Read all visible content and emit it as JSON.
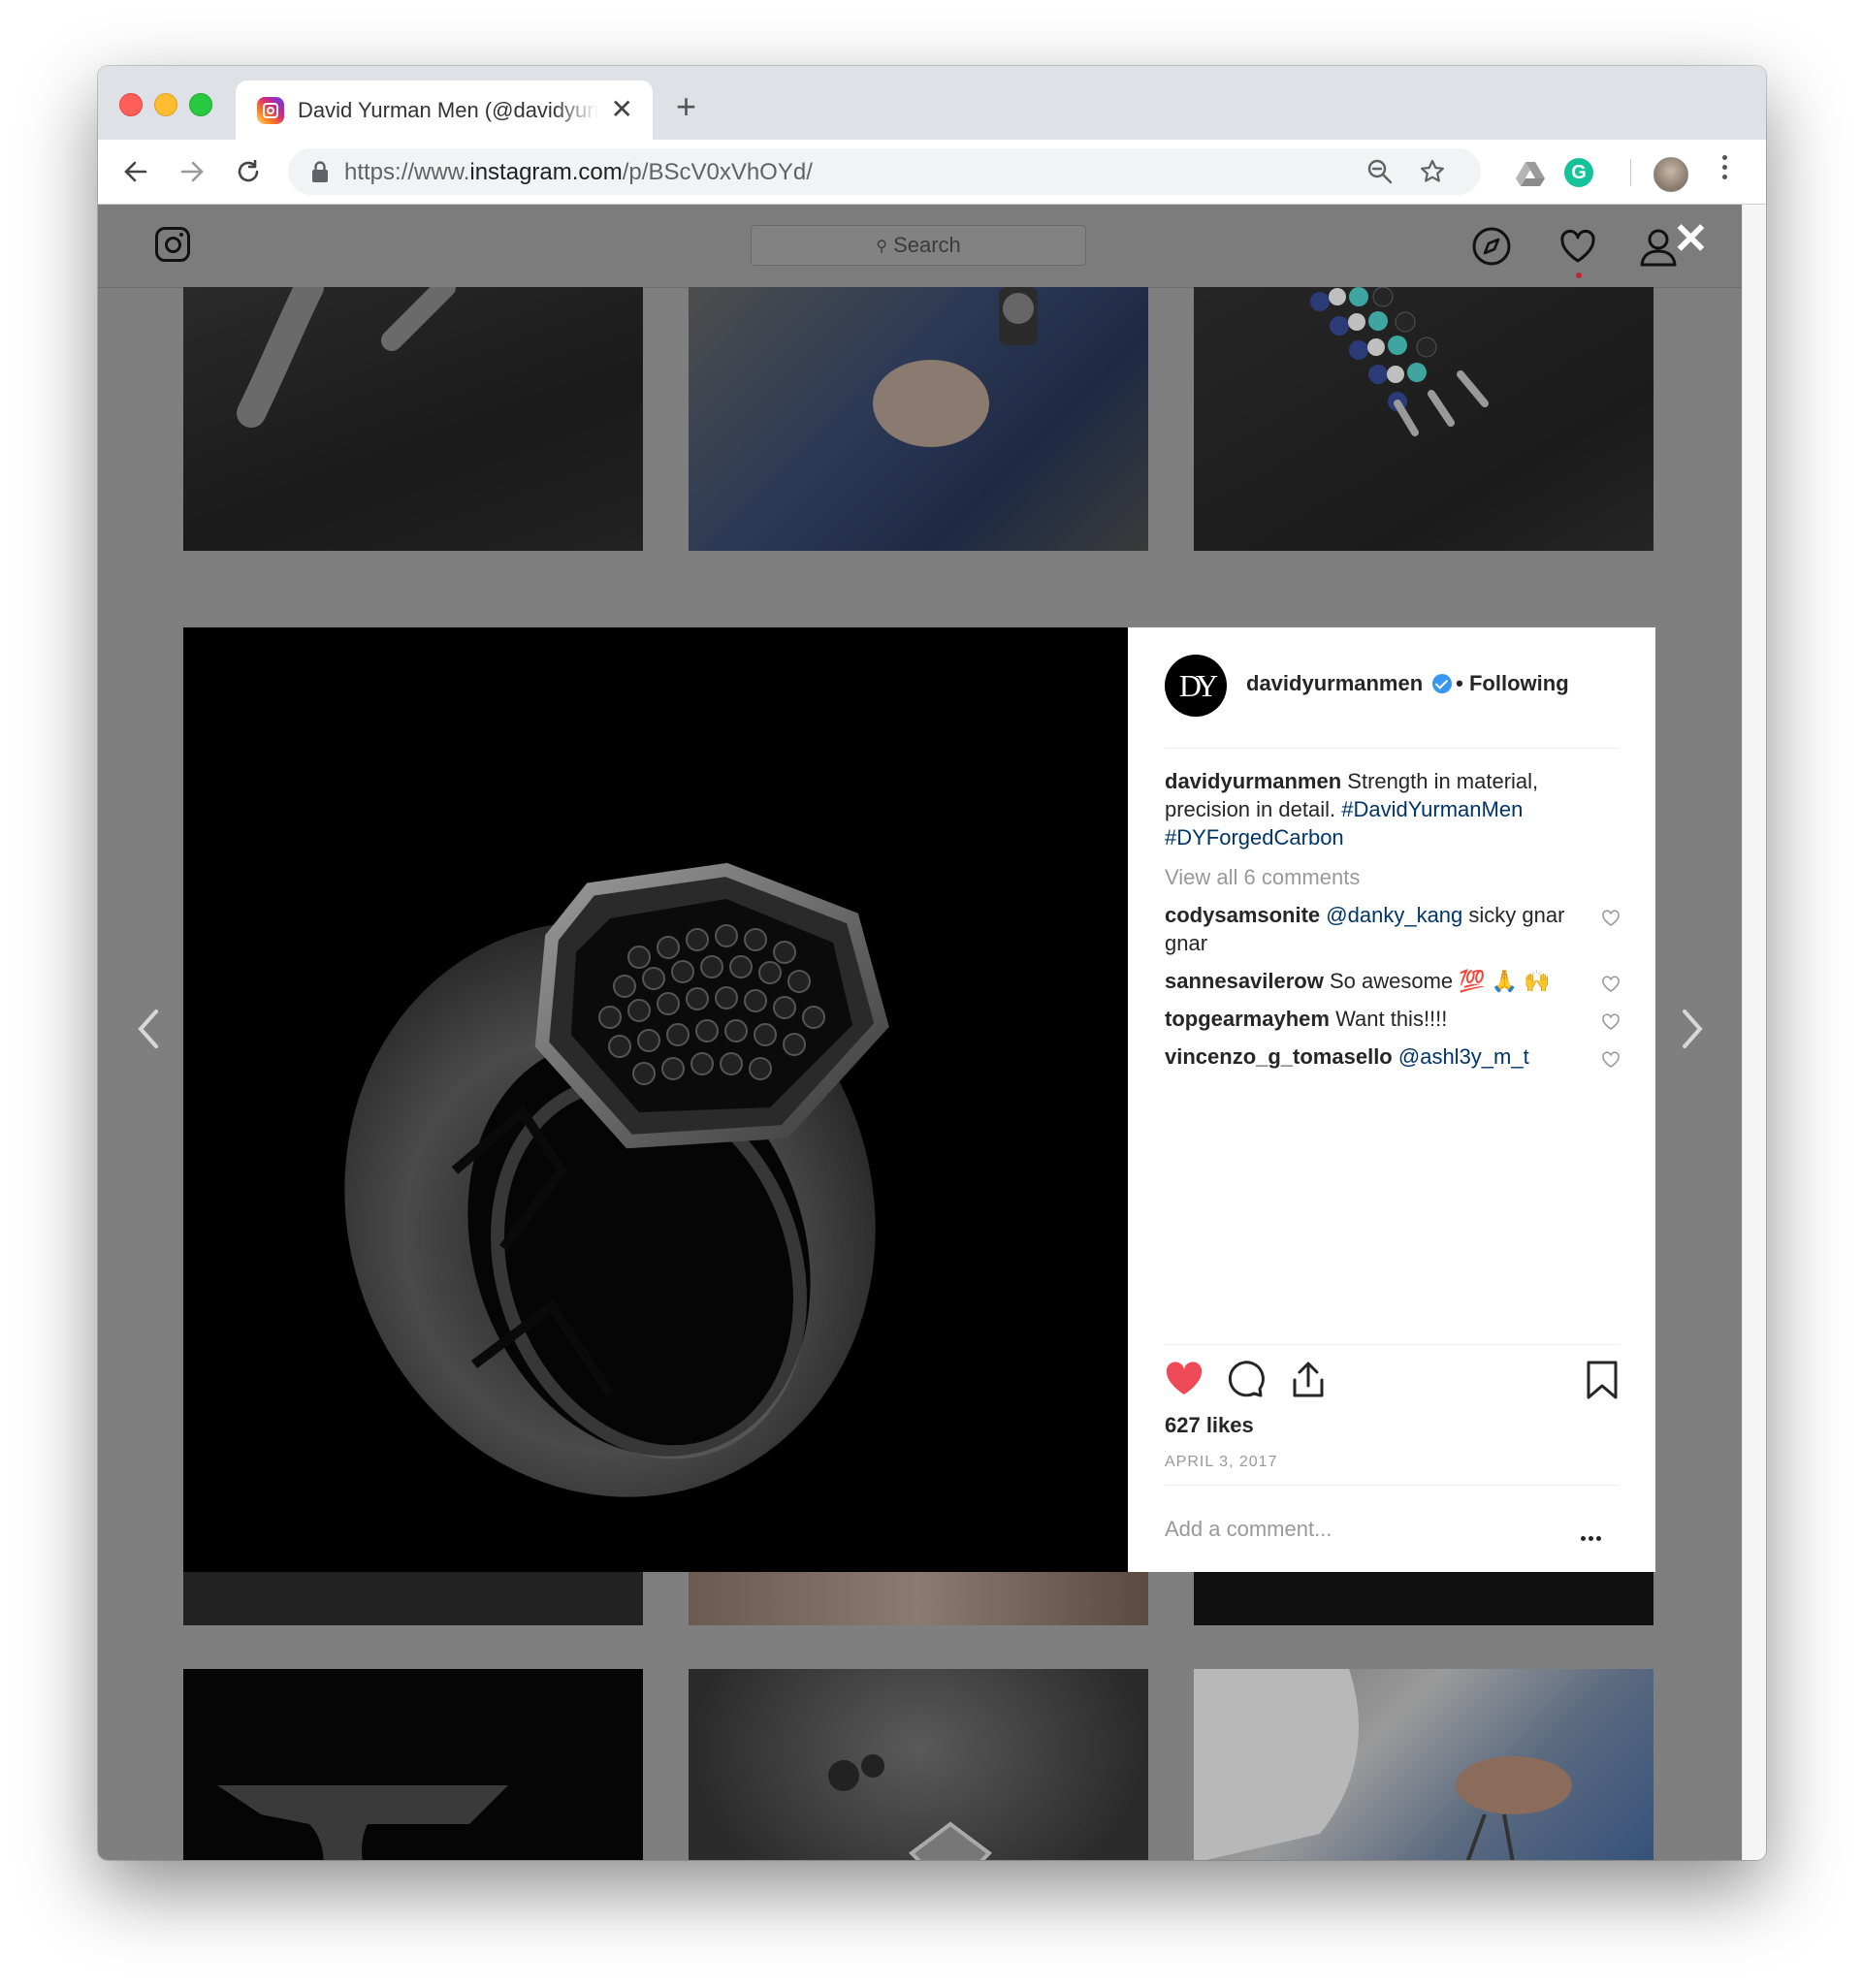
{
  "browser": {
    "tab_title": "David Yurman Men (@davidyurmanmen)",
    "tab_close": "✕",
    "new_tab": "+",
    "url_prefix": "https://www.",
    "url_host": "instagram.com",
    "url_path": "/p/BScV0xVhOYd/",
    "grammarly_label": "G"
  },
  "instagram": {
    "search_placeholder": "Search",
    "close": "✕"
  },
  "post": {
    "avatar_text": "DY",
    "username": "davidyurmanmen",
    "following": "• Following",
    "caption_user": "davidyurmanmen",
    "caption_text": " Strength in material, precision in detail. ",
    "hashtag1": "#DavidYurmanMen",
    "hashtag2": "#DYForgedCarbon",
    "view_all": "View all 6 comments",
    "comments": [
      {
        "user": "codysamsonite",
        "mention": "@danky_kang",
        "text": " sicky gnar gnar"
      },
      {
        "user": "sannesavilerow",
        "mention": "",
        "text": " So awesome 💯 🙏 🙌"
      },
      {
        "user": "topgearmayhem",
        "mention": "",
        "text": " Want this!!!!"
      },
      {
        "user": "vincenzo_g_tomasello",
        "mention": "@ashl3y_m_t",
        "text": ""
      }
    ],
    "likes": "627 likes",
    "date": "APRIL 3, 2017",
    "add_comment_placeholder": "Add a comment..."
  },
  "colors": {
    "like_red": "#ed4956",
    "hashtag": "#003569",
    "verified": "#3897f0"
  }
}
